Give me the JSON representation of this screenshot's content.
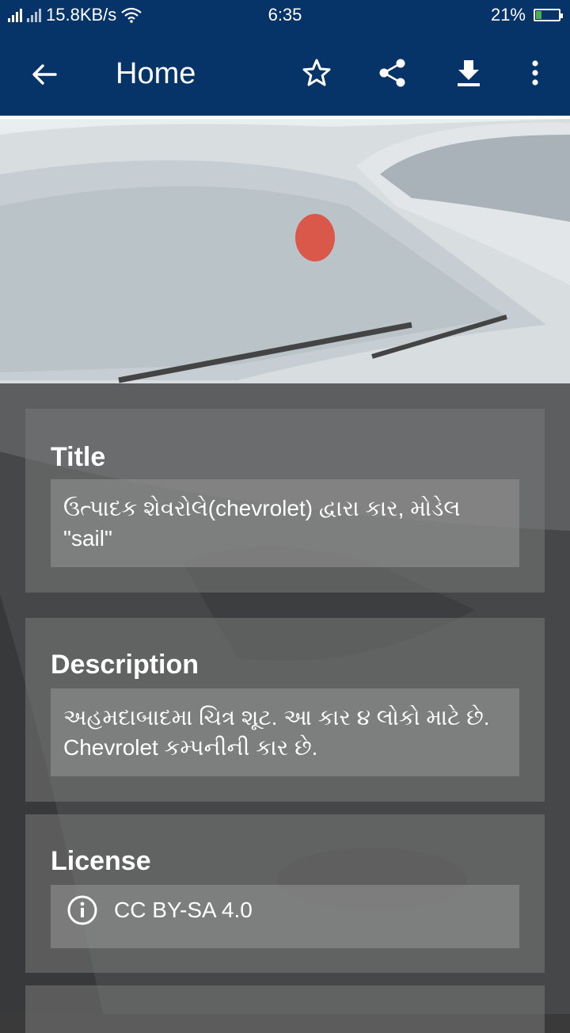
{
  "status_bar": {
    "network_speed": "15.8KB/s",
    "time": "6:35",
    "battery_percent": "21%"
  },
  "app_bar": {
    "title": "Home",
    "actions": [
      "back-arrow-icon",
      "star-icon",
      "share-icon",
      "download-icon",
      "more-vert-icon"
    ]
  },
  "details": {
    "title_label": "Title",
    "title_value": "ઉત્પાદક શેવરોલે(chevrolet) દ્વારા કાર, મોડેલ \"sail\"",
    "description_label": "Description",
    "description_value": "અહમદાબાદમા ચિત્ર શૂટ. આ કાર ૪ લોકો માટે છે. Chevrolet કમ્પનીની કાર છે.",
    "license_label": "License",
    "license_value": "CC BY-SA 4.0"
  },
  "colors": {
    "app_bar": "#063469",
    "text": "#ffffff"
  }
}
